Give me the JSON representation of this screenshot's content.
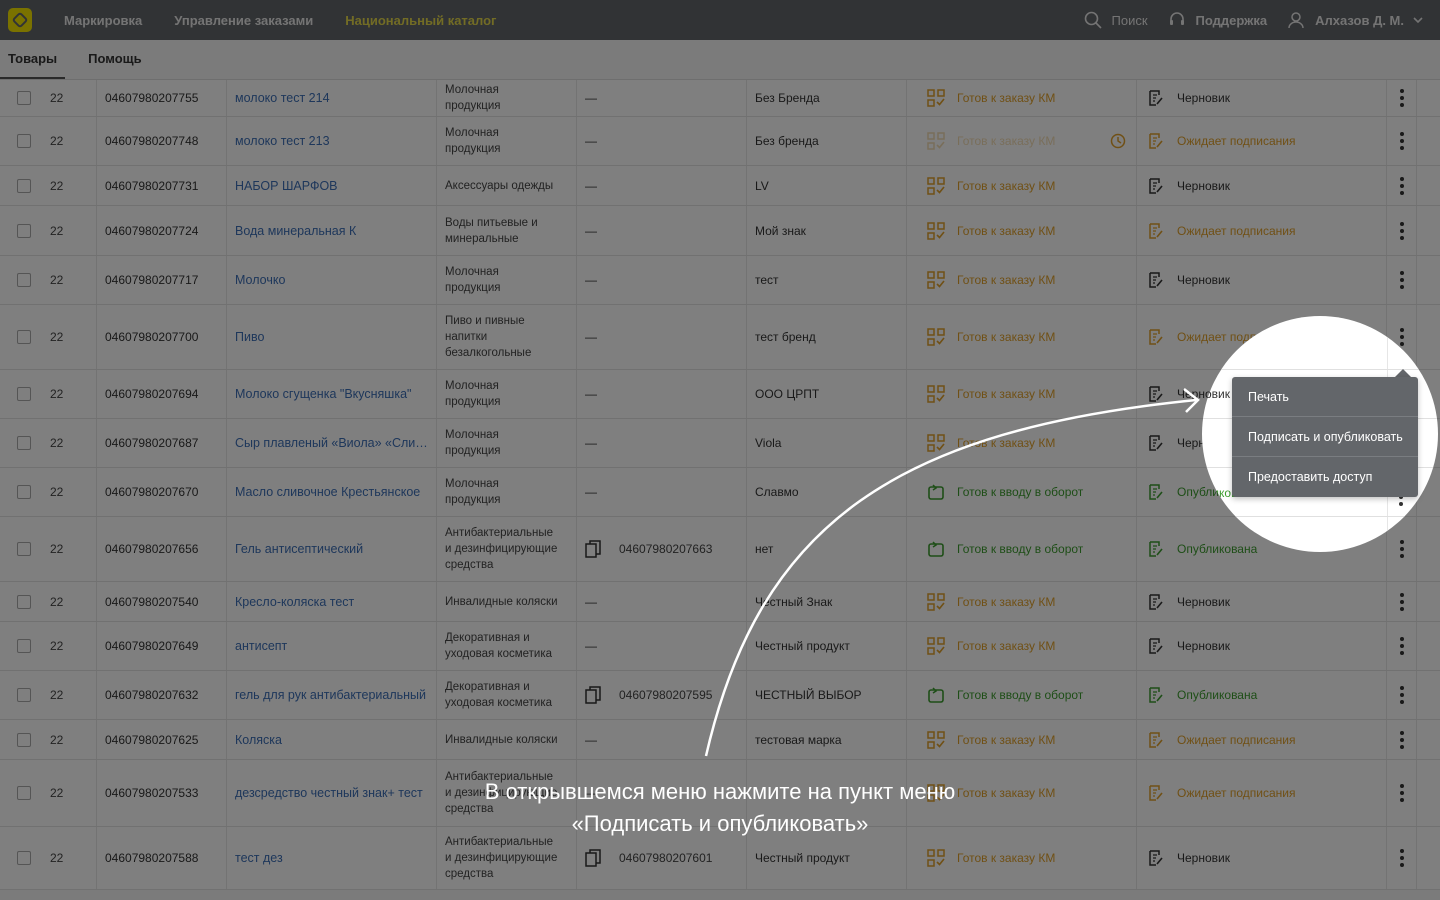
{
  "topbar": {
    "nav": [
      "Маркировка",
      "Управление заказами",
      "Национальный каталог"
    ],
    "search_label": "Поиск",
    "support_label": "Поддержка",
    "user_name": "Алхазов Д. М."
  },
  "subtabs": [
    "Товары",
    "Помощь"
  ],
  "rows": [
    {
      "num": "22",
      "code": "04607980207755",
      "name": "молоко тест 214",
      "category": [
        "Молочная",
        "продукция"
      ],
      "ext_code": "",
      "brand": "Без Бренда",
      "km": "Готов к заказу КМ",
      "status": "Черновик"
    },
    {
      "num": "22",
      "code": "04607980207748",
      "name": "молоко тест 213",
      "category": [
        "Молочная",
        "продукция"
      ],
      "ext_code": "",
      "brand": "Без бренда",
      "km": "Готов к заказу КМ",
      "status": "Ожидает подписания"
    },
    {
      "num": "22",
      "code": "04607980207731",
      "name": "НАБОР ШАРФОВ",
      "category": [
        "Аксессуары одежды"
      ],
      "ext_code": "",
      "brand": "LV",
      "km": "Готов к заказу КМ",
      "status": "Черновик"
    },
    {
      "num": "22",
      "code": "04607980207724",
      "name": "Вода минеральная К",
      "category": [
        "Воды питьевые и",
        "минеральные"
      ],
      "ext_code": "",
      "brand": "Мой знак",
      "km": "Готов к заказу КМ",
      "status": "Ожидает подписания"
    },
    {
      "num": "22",
      "code": "04607980207717",
      "name": "Молочко",
      "category": [
        "Молочная",
        "продукция"
      ],
      "ext_code": "",
      "brand": "тест",
      "km": "Готов к заказу КМ",
      "status": "Черновик"
    },
    {
      "num": "22",
      "code": "04607980207700",
      "name": "Пиво",
      "category": [
        "Пиво и пивные",
        "напитки",
        "безалкогольные"
      ],
      "ext_code": "",
      "brand": "тест бренд",
      "km": "Готов к заказу КМ",
      "status": "Ожидает подписания"
    },
    {
      "num": "22",
      "code": "04607980207694",
      "name": "Молоко сгущенка \"Вкусняшка\"",
      "category": [
        "Молочная",
        "продукция"
      ],
      "ext_code": "",
      "brand": "ООО ЦРПТ",
      "km": "Готов к заказу КМ",
      "status": "Черновик"
    },
    {
      "num": "22",
      "code": "04607980207687",
      "name": "Сыр плавленый «Виола» «Сливочный»",
      "category": [
        "Молочная",
        "продукция"
      ],
      "ext_code": "",
      "brand": "Viola",
      "km": "Готов к заказу КМ",
      "status": "Черновик"
    },
    {
      "num": "22",
      "code": "04607980207670",
      "name": "Масло сливочное Крестьянское",
      "category": [
        "Молочная",
        "продукция"
      ],
      "ext_code": "",
      "brand": "Славмо",
      "km": "Готов к вводу в оборот",
      "status": "Опубликована"
    },
    {
      "num": "22",
      "code": "04607980207656",
      "name": "Гель антисептический",
      "category": [
        "Антибактериальные",
        "и дезинфицирующие",
        "средства"
      ],
      "ext_code": "04607980207663",
      "brand": "нет",
      "km": "Готов к вводу в оборот",
      "status": "Опубликована"
    },
    {
      "num": "22",
      "code": "04607980207540",
      "name": "Кресло-коляска тест",
      "category": [
        "Инвалидные коляски"
      ],
      "ext_code": "",
      "brand": "Честный Знак",
      "km": "Готов к заказу КМ",
      "status": "Черновик"
    },
    {
      "num": "22",
      "code": "04607980207649",
      "name": "антисепт",
      "category": [
        "Декоративная и",
        "уходовая косметика"
      ],
      "ext_code": "",
      "brand": "Честный продукт",
      "km": "Готов к заказу КМ",
      "status": "Черновик"
    },
    {
      "num": "22",
      "code": "04607980207632",
      "name": "гель для рук антибактериальный",
      "category": [
        "Декоративная и",
        "уходовая косметика"
      ],
      "ext_code": "04607980207595",
      "brand": "ЧЕСТНЫЙ ВЫБОР",
      "km": "Готов к вводу в оборот",
      "status": "Опубликована"
    },
    {
      "num": "22",
      "code": "04607980207625",
      "name": "Коляска",
      "category": [
        "Инвалидные коляски"
      ],
      "ext_code": "",
      "brand": "тестовая марка",
      "km": "Готов к заказу КМ",
      "status": "Ожидает подписания"
    },
    {
      "num": "22",
      "code": "04607980207533",
      "name": "дезсредство честный знак+ тест",
      "category": [
        "Антибактериальные",
        "и дезинфицирующие",
        "средства"
      ],
      "ext_code": "",
      "brand": "",
      "km": "Готов к заказу КМ",
      "status": "Ожидает подписания"
    },
    {
      "num": "22",
      "code": "04607980207588",
      "name": "тест дез",
      "category": [
        "Антибактериальные",
        "и дезинфицирующие",
        "средства"
      ],
      "ext_code": "04607980207601",
      "brand": "Честный продукт",
      "km": "Готов к заказу КМ",
      "status": "Черновик"
    }
  ],
  "empty_placeholder": "—",
  "context_menu": {
    "items": [
      "Печать",
      "Подписать и опубликовать",
      "Предоставить доступ"
    ]
  },
  "spotlight_partial": {
    "status_1": "Черновик",
    "status_2": "Опубликована"
  },
  "instruction": {
    "line1": "В открывшемся меню нажмите на пункт меню",
    "line2": "«Подписать и опубликовать»"
  },
  "colors": {
    "topbar": "#63666a",
    "active_nav": "#e4d84a",
    "link": "#3d6fb6",
    "orange": "#e0a02a",
    "green": "#3c9c2e"
  }
}
